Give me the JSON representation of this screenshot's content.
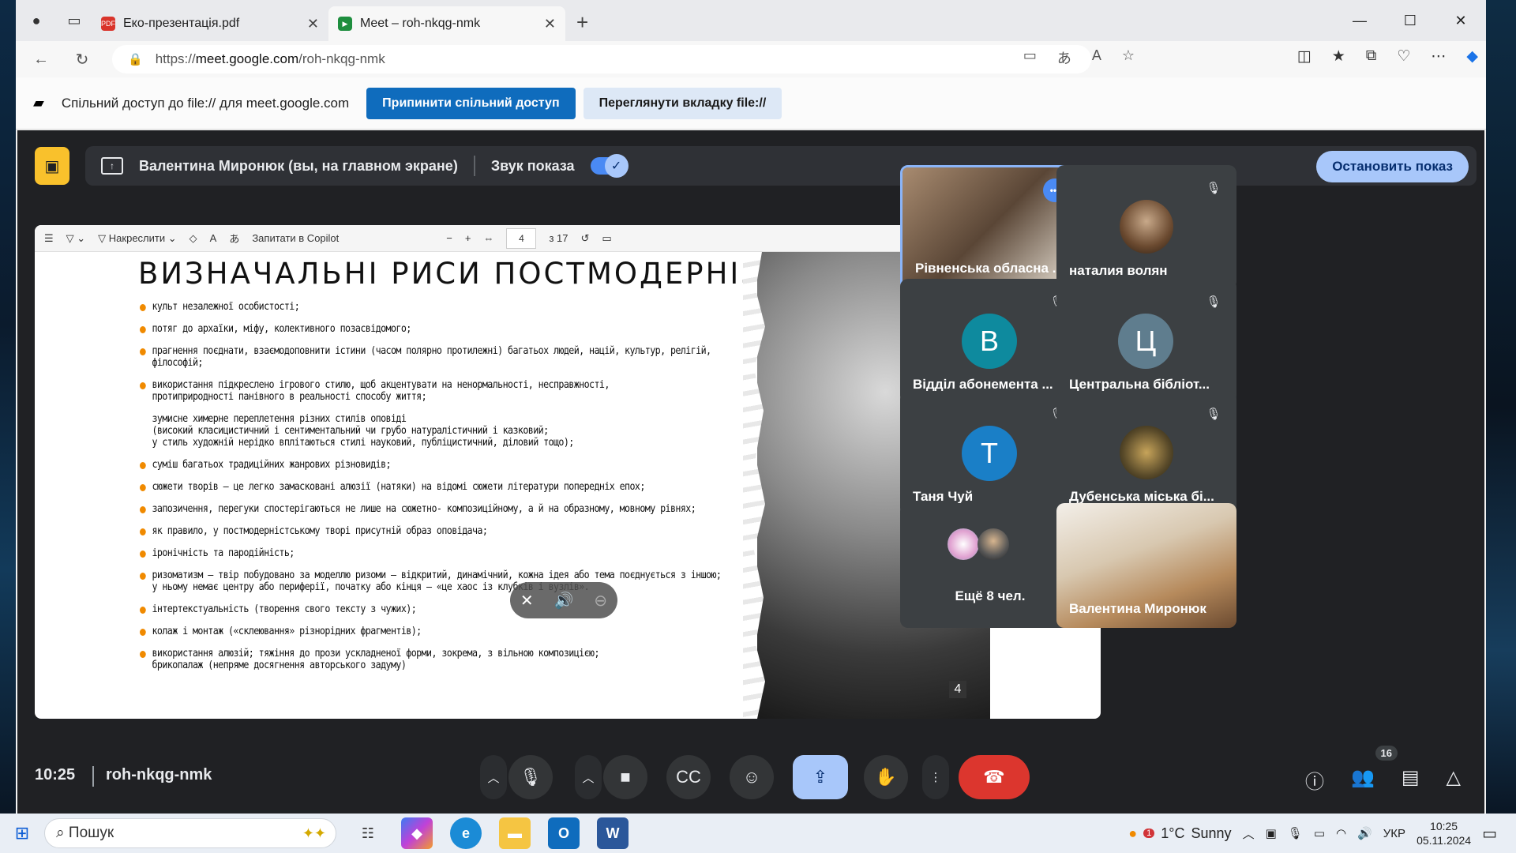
{
  "browser": {
    "tabs": [
      {
        "title": "Еко-презентація.pdf",
        "favicon": "pdf-icon",
        "active": false
      },
      {
        "title": "Meet – roh-nkqg-nmk",
        "favicon": "meet-icon",
        "active": true
      }
    ],
    "url_prefix": "https://",
    "url_host": "meet.google.com",
    "url_path": "/roh-nkqg-nmk"
  },
  "sharebar": {
    "message": "Спільний доступ до file:// для meet.google.com",
    "stop_label": "Припинити спільний доступ",
    "view_label": "Переглянути вкладку file://"
  },
  "presenting": {
    "name": "Валентина Миронюк (вы, на главном экране)",
    "sound_label": "Звук показа",
    "stop_label": "Остановить показ"
  },
  "pdf": {
    "toolbar": {
      "draw_label": "Накреслити",
      "copilot_label": "Запитати в Copilot",
      "page": "4",
      "total": "з 17"
    },
    "title": "ВИЗНАЧАЛЬНІ РИСИ ПОСТМОДЕРНІЗМУ",
    "bullets": [
      "культ незалежної особистості;",
      "потяг до архаїки, міфу,  колективного  позасвідомого;",
      "прагнення поєднати, взаємодоповнити істини (часом полярно протилежні) багатьох людей, націй, культур, релігій, філософій;",
      "використання підкреслено ігрового стилю, щоб акцентувати на ненормальності, несправжності,\nпротиприродності панівного в реальності способу життя;",
      "зумисне химерне переплетення різних стилів оповіді\n(високий класицистичний і сентиментальний чи грубо натуралістичний і казковий;\nу стиль художній нерідко вплітаються стилі науковий, публіцистичний, діловий тощо);",
      "суміш багатьох  традиційних  жанрових різновидів;",
      "сюжети творів — це легко замасковані алюзії (натяки) на відомі сюжети літератури попередніх епох;",
      "запозичення, перегуки спостерігаються не лише на сюжетно- композиційному, а й на образному, мовному рівнях;",
      "як правило, у постмодерністському творі присутній образ оповідача;",
      "іронічність та пародійність;",
      "ризоматизм – твір побудовано за моделлю ризоми – відкритий, динамічний, кожна ідея або тема поєднується з іншою;\nу ньому немає центру або периферії, початку або кінця – «це хаос із клубків і вузлів».",
      "інтертекстуальність (творення свого тексту з чужих);",
      "колаж і монтаж («склеювання» різнорідних  фрагментів);",
      "використання алюзій; тяжіння до прози ускладненої форми, зокрема, з вільною композицією;\nбрикопалаж (непряме досягнення авторського задуму)"
    ],
    "page_badge": "4"
  },
  "participants": [
    {
      "name": "Рівненська обласна ...",
      "kind": "video",
      "speaking": true
    },
    {
      "name": "наталия волян",
      "kind": "photo",
      "muted": true
    },
    {
      "name": "Відділ абонемента ...",
      "kind": "letter",
      "letter": "В",
      "color": "#0e8a9e",
      "muted": true
    },
    {
      "name": "Центральна бібліот...",
      "kind": "letter",
      "letter": "Ц",
      "color": "#5f7d8e",
      "muted": true
    },
    {
      "name": "Таня Чуй",
      "kind": "letter",
      "letter": "Т",
      "color": "#1a7fc7",
      "muted": true
    },
    {
      "name": "Дубенська міська бі...",
      "kind": "photo",
      "muted": true
    },
    {
      "name": "Ещё 8 чел.",
      "kind": "more"
    },
    {
      "name": "Валентина Миронюк",
      "kind": "video"
    }
  ],
  "bottombar": {
    "time": "10:25",
    "meeting_code": "roh-nkqg-nmk",
    "participants_count": "16"
  },
  "taskbar": {
    "search_placeholder": "Пошук",
    "weather_temp": "1°C",
    "weather_desc": "Sunny",
    "weather_alert": "1",
    "lang": "УКР",
    "clock_time": "10:25",
    "clock_date": "05.11.2024"
  }
}
